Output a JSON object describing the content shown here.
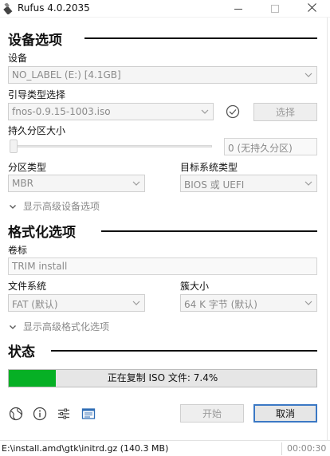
{
  "window": {
    "title": "Rufus 4.0.2035"
  },
  "drive_properties": {
    "title": "设备选项",
    "device_label": "设备",
    "device_value": "NO_LABEL (E:) [4.1GB]",
    "boot_selection_label": "引导类型选择",
    "boot_selection_value": "fnos-0.9.15-1003.iso",
    "select_button": "选择",
    "persistent_label": "持久分区大小",
    "persistent_value": "0 (无持久分区)",
    "partition_scheme_label": "分区类型",
    "partition_scheme_value": "MBR",
    "target_system_label": "目标系统类型",
    "target_system_value": "BIOS 或 UEFI",
    "advanced_toggle": "显示高级设备选项"
  },
  "format_options": {
    "title": "格式化选项",
    "volume_label": "卷标",
    "volume_value": "TRIM install",
    "file_system_label": "文件系统",
    "file_system_value": "FAT (默认)",
    "cluster_size_label": "簇大小",
    "cluster_size_value": "64 K 字节 (默认)",
    "advanced_toggle": "显示高级格式化选项"
  },
  "status": {
    "title": "状态",
    "progress_text": "正在复制 ISO 文件: 7.4%",
    "progress_fraction": 0.153,
    "progress_color": "#06b025"
  },
  "toolbar": {
    "icons": [
      "globe-icon",
      "info-icon",
      "settings-sliders-icon",
      "log-icon"
    ],
    "start_button": "开始",
    "cancel_button": "取消"
  },
  "statusbar": {
    "text": "E:\\install.amd\\gtk\\initrd.gz (140.3 MB)",
    "timer": "00:00:30"
  },
  "colors": {
    "accent": "#3b78c4",
    "progress": "#06b025"
  }
}
